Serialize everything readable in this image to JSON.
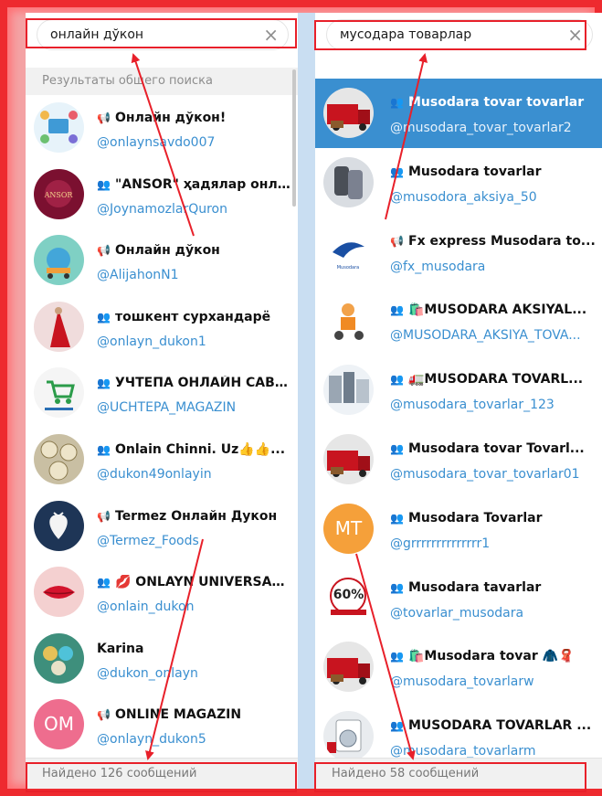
{
  "left_panel": {
    "search": {
      "value": "онлайн дўкон"
    },
    "section_header": "Результаты общего поиска",
    "footer": "Найдено 126 сообщений",
    "items": [
      {
        "title": "Онлайн дўкон!",
        "username": "@onlaynsavdo007",
        "kind": "channel",
        "avatar": "shop-icons"
      },
      {
        "title": "\"ANSOR\" ҳадялар онла...",
        "username": "@JoynamozlarQuron",
        "kind": "group",
        "avatar": "ansor-gift"
      },
      {
        "title": "Онлайн дўкон",
        "username": "@AlijahonN1",
        "kind": "channel",
        "avatar": "cart-globe"
      },
      {
        "title": "тошкент сурхандарё",
        "username": "@onlayn_dukon1",
        "kind": "group",
        "avatar": "red-dress"
      },
      {
        "title": "УЧТЕПА ОНЛАЙН САВД...",
        "username": "@UCHTEPA_MAGAZIN",
        "kind": "group",
        "avatar": "uzbekistan-cart"
      },
      {
        "title": "Onlain Chinni. Uz👍👍...",
        "username": "@dukon49onlayin",
        "kind": "group",
        "avatar": "chinaware"
      },
      {
        "title": "Termez Онлайн Дукон",
        "username": "@Termez_Foods",
        "kind": "channel",
        "avatar": "strawberry"
      },
      {
        "title": "💋 ONLAYN UNIVERSAL ...",
        "username": "@onlain_dukon",
        "kind": "group",
        "avatar": "lips"
      },
      {
        "title": "Karina",
        "username": "@dukon_onlayn",
        "kind": "none",
        "avatar": "jewelry"
      },
      {
        "title": "ONLINE MAGAZIN",
        "username": "@onlayn_dukon5",
        "kind": "channel",
        "avatar": "initials",
        "initials": "OM",
        "color": "#ee6d8e"
      }
    ]
  },
  "right_panel": {
    "search": {
      "value": "мусодара товарлар"
    },
    "footer": "Найдено 58 сообщений",
    "items": [
      {
        "title": "Musodara tovar tovarlar",
        "username": "@musodara_tovar_tovarlar2",
        "kind": "group",
        "avatar": "red-truck",
        "selected": true
      },
      {
        "title": "Musodara tovarlar",
        "username": "@musodora_aksiya_50",
        "kind": "group",
        "avatar": "phones"
      },
      {
        "title": "Fx express Musodara to...",
        "username": "@fx_musodara",
        "kind": "channel",
        "avatar": "fx-logo"
      },
      {
        "title": "🛍️MUSODARA AKSIYAL...",
        "username": "@MUSODARA_AKSIYA_TOVA...",
        "kind": "group",
        "avatar": "delivery-man"
      },
      {
        "title": "🚛MUSODARA TOVARL...",
        "username": "@musodara_tovarlar_123",
        "kind": "group",
        "avatar": "appliances"
      },
      {
        "title": "Musodara tovar Tovarl...",
        "username": "@musodara_tovar_tovarlar01",
        "kind": "group",
        "avatar": "red-truck"
      },
      {
        "title": "Musodara Tovarlar",
        "username": "@grrrrrrrrrrrrrr1",
        "kind": "group",
        "avatar": "initials",
        "initials": "MT",
        "color": "#f5a03a"
      },
      {
        "title": "Musodara tavarlar",
        "username": "@tovarlar_musodara",
        "kind": "group",
        "avatar": "sale-60",
        "badge": "60%"
      },
      {
        "title": "🛍️Musodara tovar 🧥🧣",
        "username": "@musodara_tovarlarw",
        "kind": "group",
        "avatar": "red-truck"
      },
      {
        "title": "MUSODARA TOVARLAR ...",
        "username": "@musodara_tovarlarm",
        "kind": "group",
        "avatar": "washing-machine"
      }
    ]
  },
  "colors": {
    "accent_blue": "#3a8fd0",
    "annotation_red": "#e8202a"
  }
}
